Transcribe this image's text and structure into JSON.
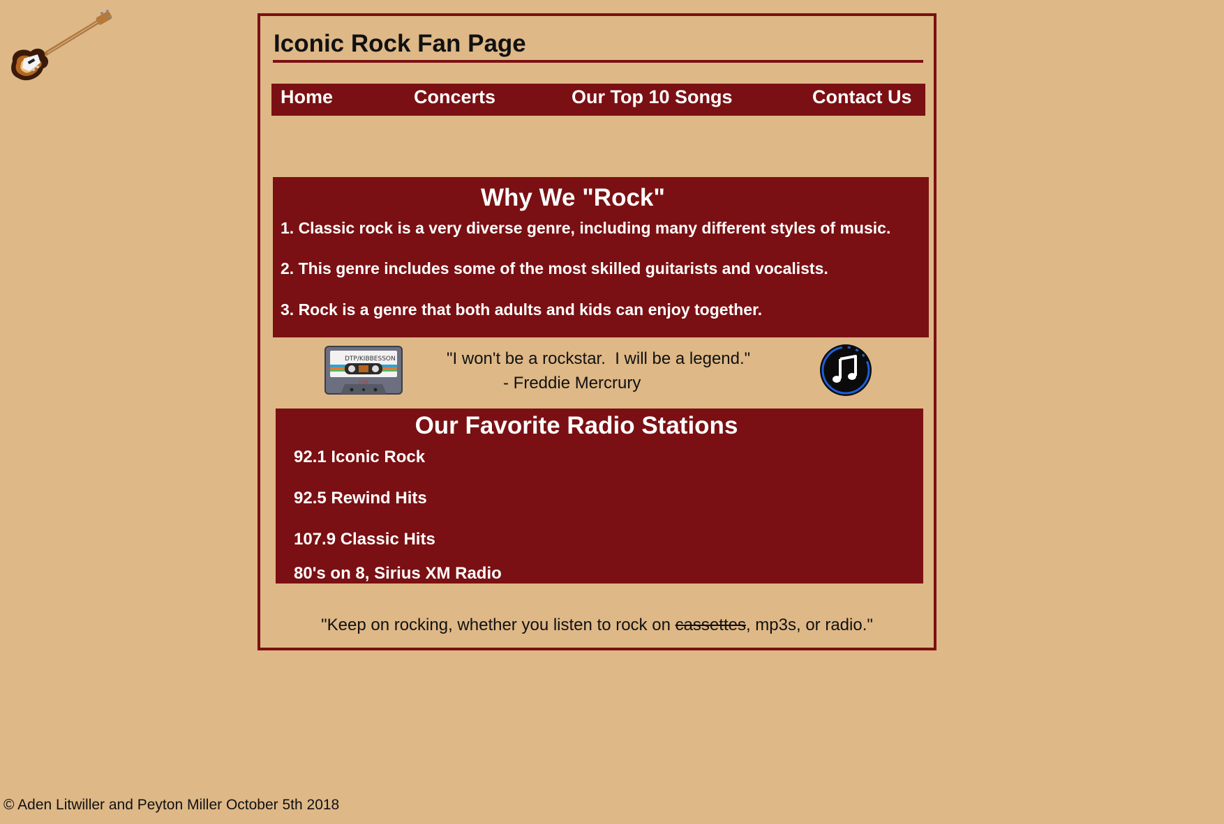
{
  "site": {
    "title": "Iconic Rock Fan Page"
  },
  "nav": {
    "items": [
      {
        "label": "Home"
      },
      {
        "label": "Concerts"
      },
      {
        "label": "Our Top 10 Songs"
      },
      {
        "label": "Contact Us"
      }
    ]
  },
  "why_section": {
    "heading": "Why We \"Rock\"",
    "items": [
      "1. Classic rock is a very diverse genre, including many different styles of music.",
      "2. This genre includes some of the most skilled guitarists and vocalists.",
      "3. Rock is a genre that both adults and kids can enjoy together."
    ]
  },
  "quote": {
    "text": "\"I won't be a rockstar.  I will be a legend.\"",
    "author": "- Freddie Mercrury"
  },
  "images": {
    "guitar": "bass-guitar-icon",
    "cassette": "cassette-tape-icon",
    "music": "music-note-icon",
    "cassette_label": "DTP/KIBBESSON",
    "cassette_small": "C90"
  },
  "radio_section": {
    "heading": "Our Favorite Radio Stations",
    "stations": [
      "92.1 Iconic Rock",
      "92.5 Rewind Hits",
      "107.9 Classic Hits",
      "80's on 8, Sirius XM Radio"
    ]
  },
  "closing": {
    "before": "\"Keep on rocking, whether you listen to rock on ",
    "struck": "cassettes",
    "after": ", mp3s, or radio.\""
  },
  "footer": {
    "text": "© Aden Litwiller and Peyton Miller October 5th 2018"
  },
  "colors": {
    "background": "#deb887",
    "accent": "#7a1013",
    "panel_text": "#ffffff"
  }
}
